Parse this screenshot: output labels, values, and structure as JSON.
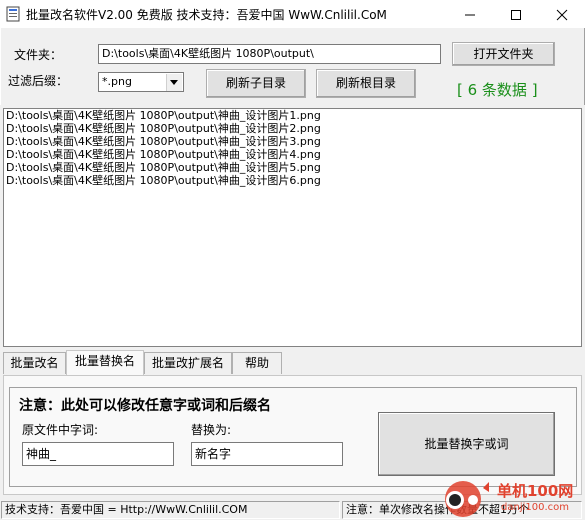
{
  "window": {
    "title": "批量改名软件V2.00   免费版    技术支持：吾爱中国   WwW.Cnlilil.CoM"
  },
  "top": {
    "folder_label": "文件夹：",
    "folder_value": "D:\\tools\\桌面\\4K壁纸图片 1080P\\output\\",
    "open_folder_button": "打开文件夹",
    "filter_label": "过滤后缀：",
    "filter_value": "*.png",
    "refresh_sub_button": "刷新子目录",
    "refresh_root_button": "刷新根目录",
    "count_text": "[ 6 条数据 ]"
  },
  "files": [
    "D:\\tools\\桌面\\4K壁纸图片 1080P\\output\\神曲_设计图片1.png",
    "D:\\tools\\桌面\\4K壁纸图片 1080P\\output\\神曲_设计图片2.png",
    "D:\\tools\\桌面\\4K壁纸图片 1080P\\output\\神曲_设计图片3.png",
    "D:\\tools\\桌面\\4K壁纸图片 1080P\\output\\神曲_设计图片4.png",
    "D:\\tools\\桌面\\4K壁纸图片 1080P\\output\\神曲_设计图片5.png",
    "D:\\tools\\桌面\\4K壁纸图片 1080P\\output\\神曲_设计图片6.png"
  ],
  "tabs": [
    "批量改名",
    "批量替换名",
    "批量改扩展名",
    "帮助"
  ],
  "active_tab": "批量替换名",
  "replace_panel": {
    "note": "注意：此处可以修改任意字或词和后缀名",
    "original_label": "原文件中字词:",
    "original_value": "神曲_",
    "replace_label": "替换为:",
    "replace_value": "新名字",
    "replace_button": "批量替换字或词"
  },
  "status": {
    "left": "技术支持：吾爱中国 = Http://WwW.Cnlilil.COM",
    "right": "注意：单次修改名操作数量不超1万个"
  },
  "watermark": {
    "text": "单机100网",
    "subtext": "danji100.com"
  },
  "colors": {
    "count_green": "#1a8f1a",
    "watermark_red": "#e0422e"
  }
}
